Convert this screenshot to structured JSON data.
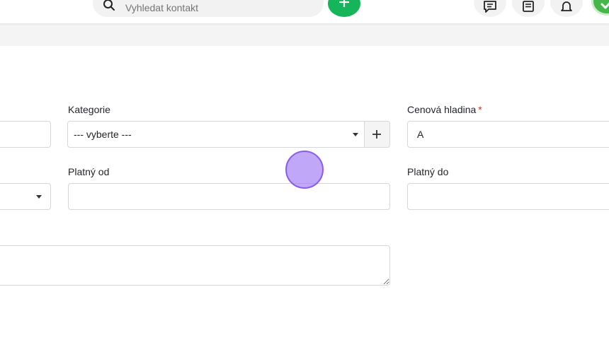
{
  "header": {
    "search": {
      "placeholder": "Vyhledat kontakt"
    },
    "add_icon": "plus-icon",
    "icons": [
      "chat-icon",
      "notes-icon",
      "bell-icon"
    ],
    "avatar_icon": "check-icon"
  },
  "form": {
    "kategorie": {
      "label": "Kategorie",
      "value": "--- vyberte ---"
    },
    "cenova_hladina": {
      "label": "Cenová hladina",
      "required_mark": "*",
      "value": "A"
    },
    "platny_od": {
      "label": "Platný od",
      "value": ""
    },
    "platny_do": {
      "label": "Platný do",
      "value": ""
    }
  },
  "colors": {
    "accent_green": "#17b55a",
    "required_red": "#c0392b",
    "cursor_purple": "#a078f5"
  }
}
